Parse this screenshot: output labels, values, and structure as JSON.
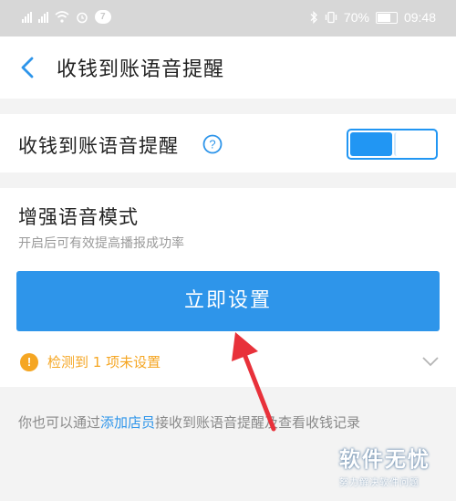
{
  "status_bar": {
    "battery": "70%",
    "notification_count": "7",
    "time": "09:48"
  },
  "header": {
    "title": "收钱到账语音提醒"
  },
  "voice_reminder": {
    "label": "收钱到账语音提醒",
    "toggle_on": true
  },
  "enhanced_mode": {
    "title": "增强语音模式",
    "description": "开启后可有效提高播报成功率",
    "button_label": "立即设置",
    "warning_icon": "!",
    "warning_text": "检测到 1 项未设置"
  },
  "footer": {
    "prefix": "你也可以通过",
    "link": "添加店员",
    "suffix": "接收到账语音提醒及查看收钱记录"
  },
  "watermark": {
    "title": "软件无忧",
    "subtitle": "努力解决软件问题"
  },
  "colors": {
    "accent": "#2e95ea",
    "warning": "#f5a623",
    "statusbar": "#d7d7d7",
    "arrow": "#e8313a"
  }
}
